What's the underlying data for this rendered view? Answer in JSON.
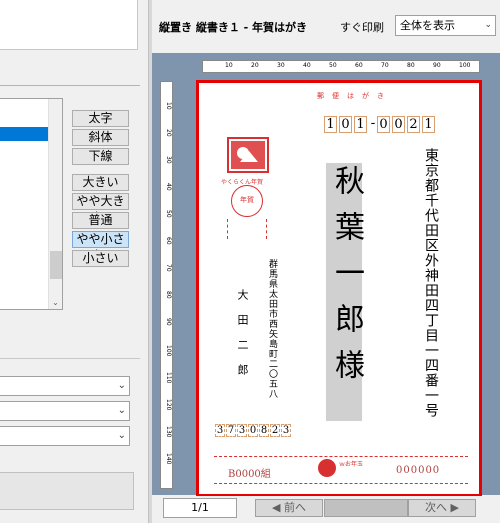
{
  "header": {
    "title": "縦置き 縦書き１ - 年賀はがき",
    "print_label": "すぐ印刷",
    "view_select": "全体を表示"
  },
  "style_buttons": [
    "太字",
    "斜体",
    "下線"
  ],
  "size_buttons": [
    "大きい",
    "やや大きい",
    "普通",
    "やや小さい",
    "小さい"
  ],
  "size_selected": "やや小さい",
  "ruler": {
    "top": [
      "10",
      "20",
      "30",
      "40",
      "50",
      "60",
      "70",
      "80",
      "90",
      "100"
    ],
    "left": [
      "10",
      "20",
      "30",
      "40",
      "50",
      "60",
      "70",
      "80",
      "90",
      "100",
      "110",
      "120",
      "130",
      "140"
    ]
  },
  "card": {
    "header": "郵便はがき",
    "stamp_caption": "やくらくん年賀",
    "nenga": "年賀",
    "zip_to": [
      "1",
      "0",
      "1",
      "-",
      "0",
      "0",
      "2",
      "1"
    ],
    "address_to": "東京都千代田区外神田四丁目一四番一号",
    "name_to": "秋葉一郎様",
    "address_from": "群馬県太田市西矢島町二〇五八",
    "name_from": "大田二郎",
    "zip_from": [
      "3",
      "7",
      "3",
      "0",
      "8",
      "2",
      "3"
    ],
    "lottery_left": "B0000組",
    "lottery_right": "000000",
    "lottery_year": "ｗお年玉"
  },
  "footer": {
    "page": "1/1",
    "prev": "◀ 前へ",
    "next": "次へ ▶"
  },
  "colors": {
    "accent": "#e60000",
    "preview_bg": "#7f95ad",
    "selected": "#0078d7"
  }
}
